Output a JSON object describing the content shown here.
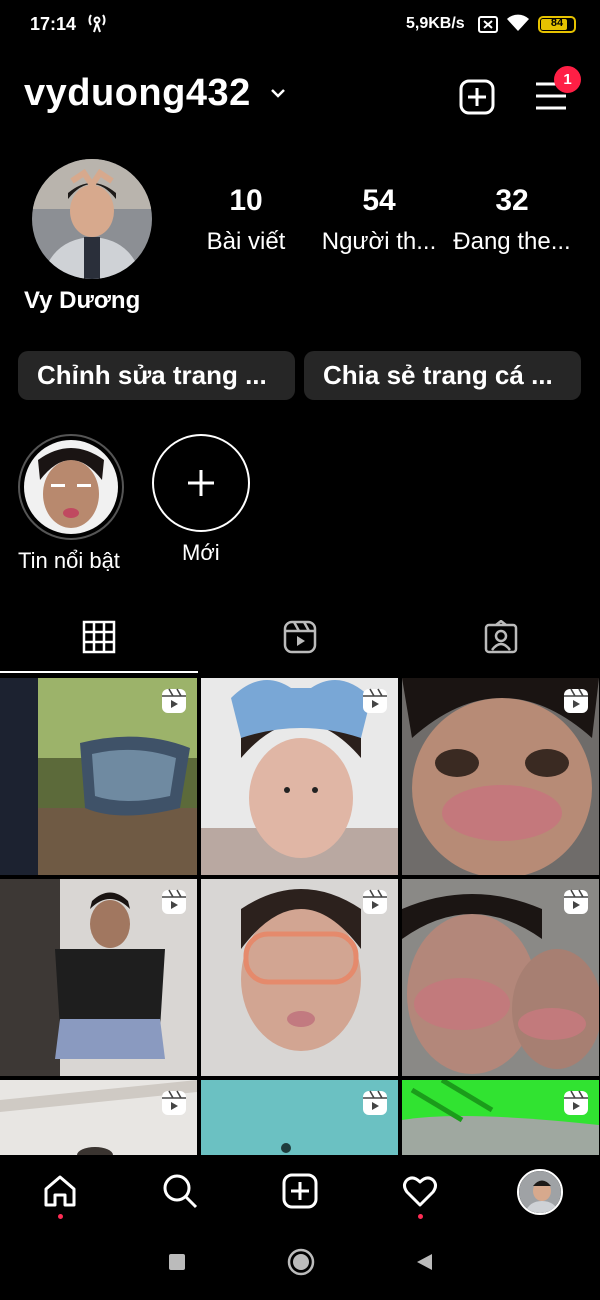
{
  "status": {
    "time": "17:14",
    "speed": "5,9KB/s",
    "battery": "84"
  },
  "header": {
    "username": "vyduong432",
    "notifications": "1"
  },
  "profile": {
    "display_name": "Vy Dương",
    "stats": [
      {
        "value": "10",
        "label": "Bài viết"
      },
      {
        "value": "54",
        "label": "Người th..."
      },
      {
        "value": "32",
        "label": "Đang the..."
      }
    ],
    "edit_button": "Chỉnh sửa trang ...",
    "share_button": "Chia sẻ trang cá ..."
  },
  "highlights": [
    {
      "label": "Tin nổi bật"
    },
    {
      "label": "Mới"
    }
  ],
  "tabs": [
    "grid-icon",
    "reels-icon",
    "tagged-icon"
  ],
  "colors": {
    "background": "#000000",
    "button": "#262626",
    "badge": "#ff1f45",
    "battery": "#e6c200"
  },
  "nav": [
    "home-icon",
    "search-icon",
    "create-icon",
    "heart-icon",
    "profile-avatar"
  ]
}
